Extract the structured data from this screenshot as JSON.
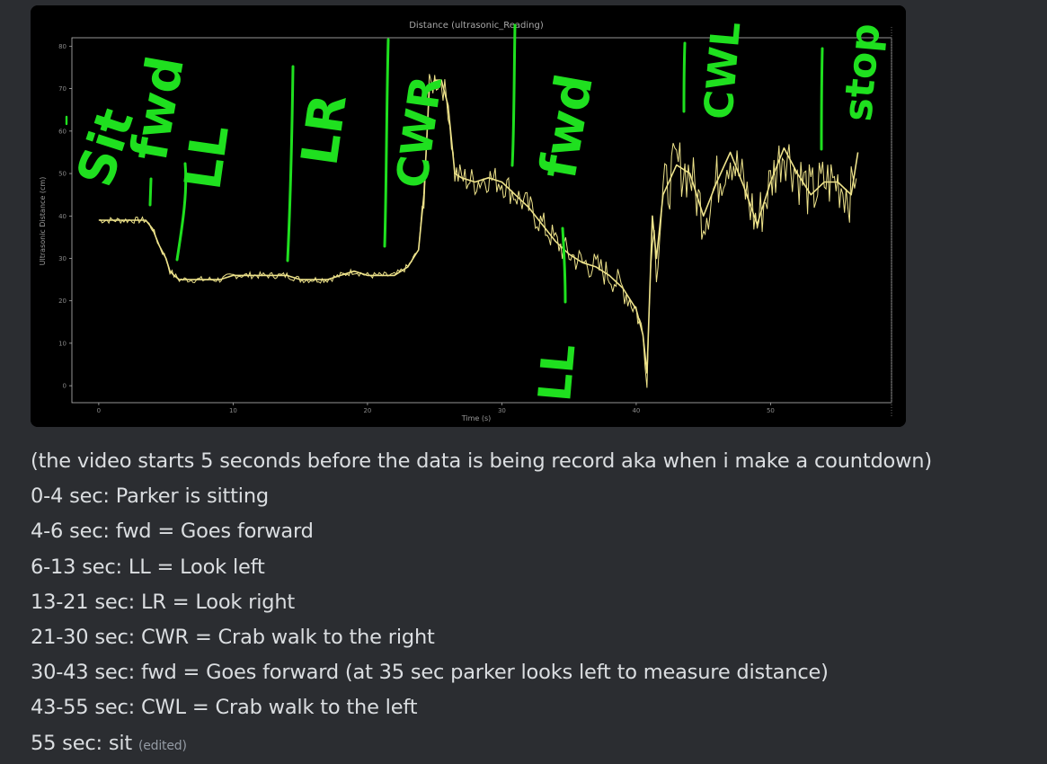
{
  "attachment": {
    "chart_data": {
      "type": "line",
      "title": "Distance (ultrasonic_Reading)",
      "xlabel": "Time (s)",
      "ylabel": "Ultrasonic Distance (cm)",
      "xticks": [
        "0",
        "10",
        "20",
        "30",
        "40",
        "50"
      ],
      "yticks": [
        "0",
        "10",
        "20",
        "30",
        "40",
        "50",
        "60",
        "70",
        "80"
      ],
      "xlim": [
        -2,
        59
      ],
      "ylim": [
        -4,
        82
      ],
      "grid": false,
      "series": [
        {
          "color": "#ede28a",
          "points": [
            [
              0,
              39
            ],
            [
              1,
              39
            ],
            [
              2,
              39
            ],
            [
              3,
              39
            ],
            [
              3.5,
              39
            ],
            [
              4,
              37
            ],
            [
              4.5,
              33
            ],
            [
              5,
              30
            ],
            [
              5.3,
              27
            ],
            [
              5.6,
              26
            ],
            [
              6,
              25
            ],
            [
              7,
              25
            ],
            [
              8,
              25
            ],
            [
              9,
              25
            ],
            [
              10,
              26
            ],
            [
              11,
              26
            ],
            [
              12,
              26
            ],
            [
              13,
              26
            ],
            [
              14,
              26
            ],
            [
              15,
              25
            ],
            [
              16,
              25
            ],
            [
              17,
              25
            ],
            [
              18,
              26
            ],
            [
              19,
              27
            ],
            [
              20,
              26
            ],
            [
              21,
              26
            ],
            [
              22,
              26
            ],
            [
              23,
              28
            ],
            [
              23.8,
              32
            ],
            [
              24.2,
              45
            ],
            [
              24.6,
              70
            ],
            [
              25,
              72
            ],
            [
              25.5,
              72
            ],
            [
              26,
              66
            ],
            [
              26.5,
              50
            ],
            [
              27,
              49
            ],
            [
              28,
              48
            ],
            [
              29,
              49
            ],
            [
              30,
              48
            ],
            [
              31,
              45
            ],
            [
              32,
              42
            ],
            [
              33,
              38
            ],
            [
              34,
              34
            ],
            [
              35,
              31
            ],
            [
              36,
              29
            ],
            [
              37,
              28
            ],
            [
              38,
              26
            ],
            [
              39,
              23
            ],
            [
              40,
              18
            ],
            [
              40.5,
              12
            ],
            [
              40.8,
              3
            ],
            [
              41.2,
              40
            ],
            [
              41.5,
              30
            ],
            [
              42,
              45
            ],
            [
              43,
              52
            ],
            [
              44,
              50
            ],
            [
              45,
              40
            ],
            [
              46,
              48
            ],
            [
              47,
              55
            ],
            [
              48,
              47
            ],
            [
              49,
              38
            ],
            [
              50,
              48
            ],
            [
              51,
              56
            ],
            [
              52,
              50
            ],
            [
              53,
              45
            ],
            [
              54,
              48
            ],
            [
              55,
              48
            ],
            [
              56,
              45
            ],
            [
              56.5,
              55
            ]
          ]
        }
      ]
    },
    "annotations": {
      "sit": "Sit",
      "fwd1": "fwd",
      "ll1": "LL",
      "lr": "LR",
      "cwr": "CWR",
      "fwd2": "fwd",
      "ll2": "LL",
      "cwl": "CWL",
      "stop": "stop"
    }
  },
  "message": {
    "lines": [
      "(the video starts 5 seconds before the data is being record aka when i make a countdown)",
      "0-4 sec: Parker is sitting",
      "4-6 sec: fwd = Goes forward",
      "6-13 sec: LL =  Look left",
      "13-21 sec: LR = Look right",
      "21-30 sec: CWR = Crab walk to the right",
      "30-43 sec: fwd = Goes forward (at 35 sec parker looks left to measure distance)",
      "43-55 sec: CWL = Crab walk to the left",
      "55 sec: sit"
    ],
    "edited_label": "(edited)"
  },
  "colors": {
    "background": "#2b2d31",
    "text": "#dbdee1",
    "muted": "#949ba4",
    "handwriting": "#1fe01f",
    "plot_line": "#ede28a"
  }
}
